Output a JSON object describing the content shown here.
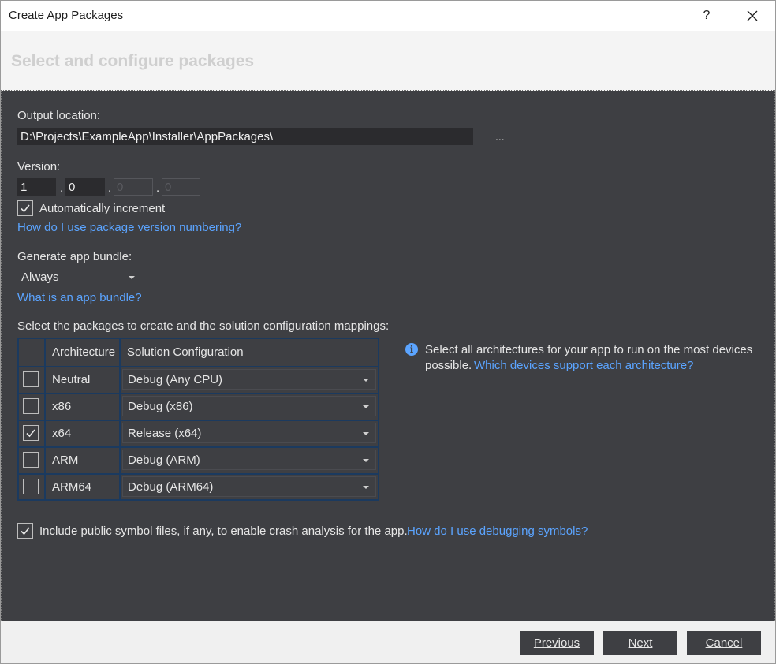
{
  "window": {
    "title": "Create App Packages",
    "help_glyph": "?",
    "close_glyph": "✕"
  },
  "header": {
    "title": "Select and configure packages"
  },
  "output": {
    "label": "Output location:",
    "value": "D:\\Projects\\ExampleApp\\Installer\\AppPackages\\",
    "browse": "..."
  },
  "version": {
    "label": "Version:",
    "parts": [
      "1",
      "0",
      "0",
      "0"
    ],
    "separator": ".",
    "auto_increment_label": "Automatically increment",
    "auto_increment_checked": true,
    "help_link": "How do I use package version numbering?"
  },
  "bundle": {
    "label": "Generate app bundle:",
    "value": "Always",
    "help_link": "What is an app bundle?"
  },
  "packages": {
    "label": "Select the packages to create and the solution configuration mappings:",
    "columns": [
      "Architecture",
      "Solution Configuration"
    ],
    "rows": [
      {
        "arch": "Neutral",
        "config": "Debug (Any CPU)",
        "checked": false
      },
      {
        "arch": "x86",
        "config": "Debug (x86)",
        "checked": false
      },
      {
        "arch": "x64",
        "config": "Release (x64)",
        "checked": true
      },
      {
        "arch": "ARM",
        "config": "Debug (ARM)",
        "checked": false
      },
      {
        "arch": "ARM64",
        "config": "Debug (ARM64)",
        "checked": false
      }
    ]
  },
  "info": {
    "text": "Select all architectures for your app to run on the most devices",
    "text2": "possible.",
    "link": "Which devices support each architecture?"
  },
  "symbols": {
    "checked": true,
    "label": "Include public symbol files, if any, to enable crash analysis for the app.",
    "link": "How do I use debugging symbols?"
  },
  "footer": {
    "previous": "Previous",
    "next": "Next",
    "cancel": "Cancel"
  },
  "colors": {
    "content_bg": "#3e3f43",
    "link": "#5ba4ff",
    "grid_border": "#1b3a5f"
  }
}
